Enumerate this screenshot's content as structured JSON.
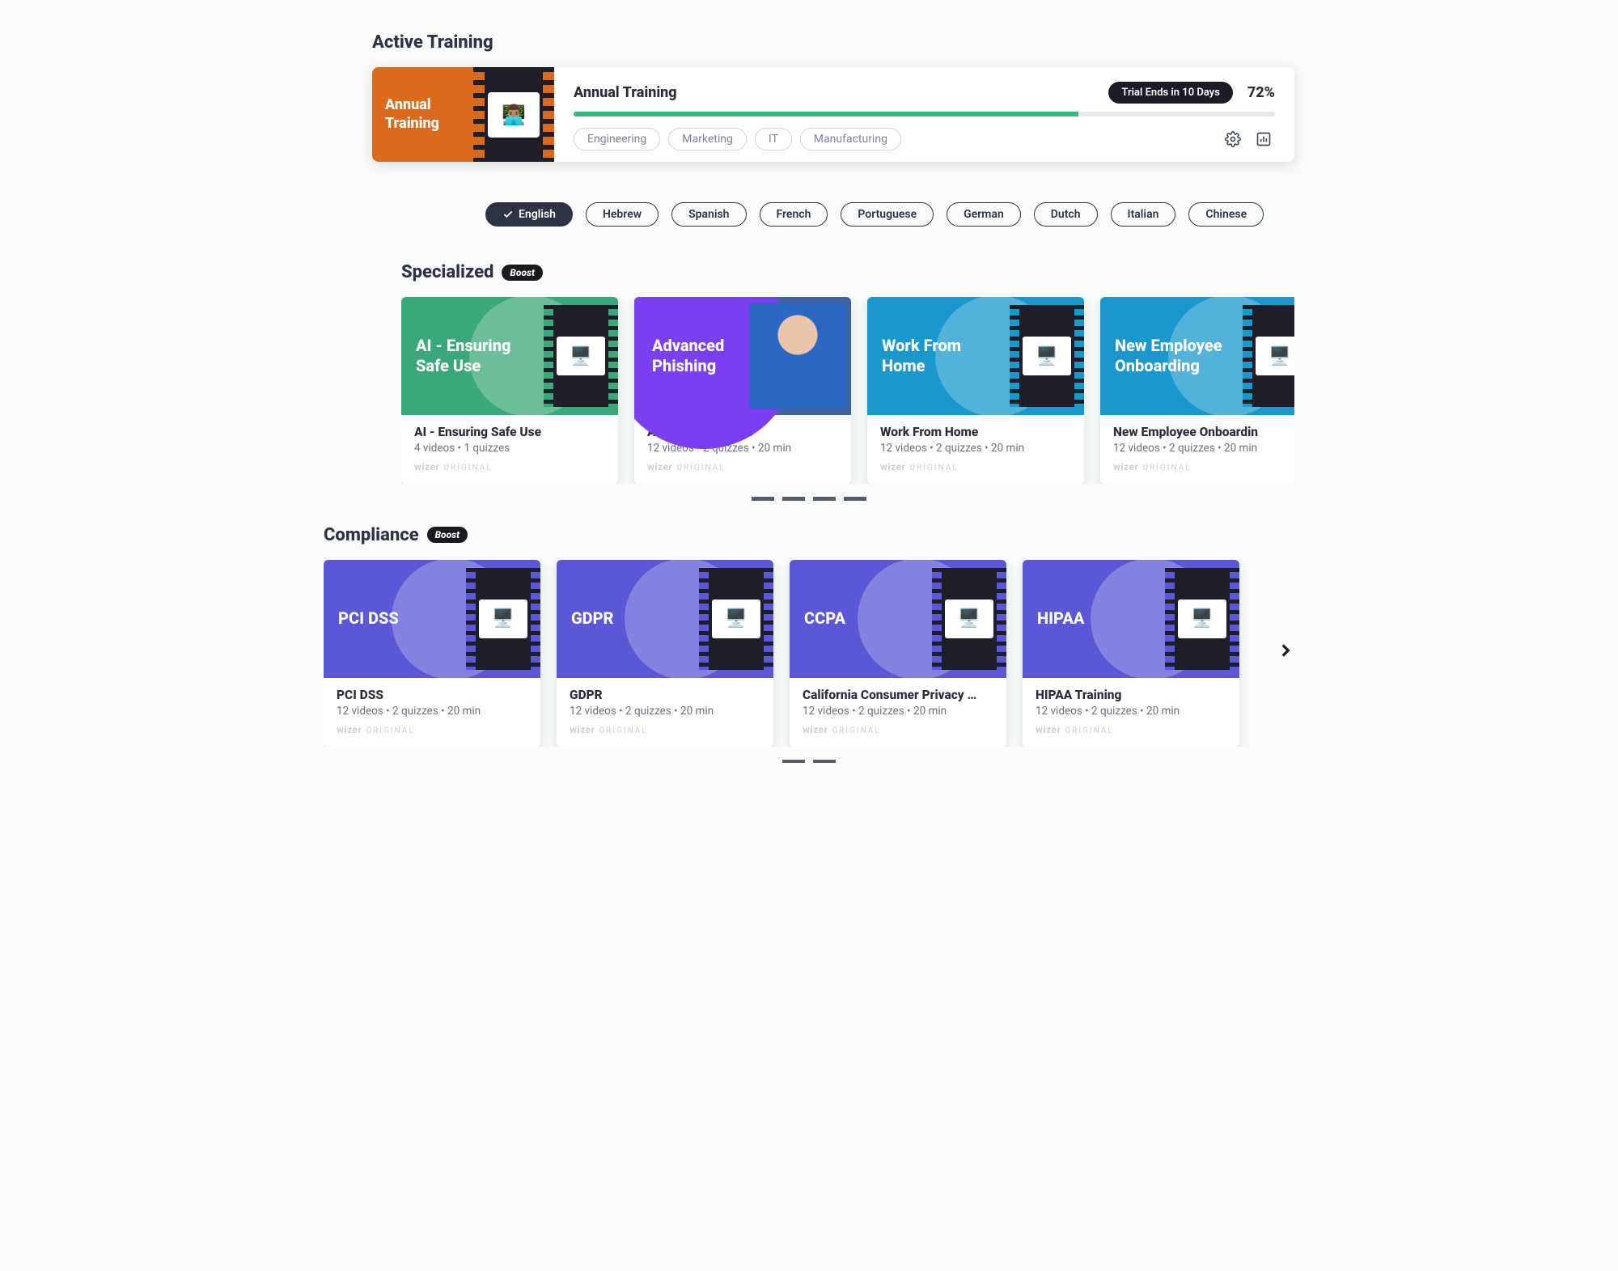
{
  "sections": {
    "active_heading": "Active Training",
    "specialized_heading": "Specialized",
    "compliance_heading": "Compliance",
    "boost_label": "Boost"
  },
  "active": {
    "thumb_label": "Annual Training",
    "title": "Annual Training",
    "trial_badge": "Trial Ends in 10 Days",
    "percent_label": "72%",
    "percent_value": 72,
    "tags": [
      "Engineering",
      "Marketing",
      "IT",
      "Manufacturing"
    ]
  },
  "languages": [
    {
      "label": "English",
      "active": true
    },
    {
      "label": "Hebrew"
    },
    {
      "label": "Spanish"
    },
    {
      "label": "French"
    },
    {
      "label": "Portuguese"
    },
    {
      "label": "German"
    },
    {
      "label": "Dutch"
    },
    {
      "label": "Italian"
    },
    {
      "label": "Chinese"
    }
  ],
  "specialized": [
    {
      "thumb_title": "AI - Ensuring Safe Use",
      "color": "green",
      "title": "AI - Ensuring Safe Use",
      "meta": "4 videos • 1 quizzes"
    },
    {
      "thumb_title": "Advanced Phishing",
      "color": "phish",
      "title": "Annual Training 20",
      "meta": "12 videos • 2 quizzes • 20 min"
    },
    {
      "thumb_title": "Work From Home",
      "color": "blue",
      "title": "Work From Home",
      "meta": "12 videos • 2 quizzes • 20 min"
    },
    {
      "thumb_title": "New Employee Onboarding",
      "color": "lblue",
      "title": "New Employee Onboardin",
      "meta": "12 videos • 2 quizzes • 20 min"
    }
  ],
  "compliance": [
    {
      "thumb_title": "PCI DSS",
      "color": "purple",
      "title": "PCI DSS",
      "meta": "12 videos • 2 quizzes • 20 min"
    },
    {
      "thumb_title": "GDPR",
      "color": "purple",
      "title": "GDPR",
      "meta": "12 videos • 2 quizzes • 20 min"
    },
    {
      "thumb_title": "CCPA",
      "color": "purple",
      "title": "California Consumer Privacy …",
      "meta": "12 videos • 2 quizzes • 20 min"
    },
    {
      "thumb_title": "HIPAA",
      "color": "purple",
      "title": "HIPAA Training",
      "meta": "12 videos • 2 quizzes • 20 min"
    }
  ],
  "brand": {
    "name": "wizer",
    "tag": "ORIGINAL"
  },
  "icons": {
    "gear": "gear-icon",
    "chart": "bar-chart-icon",
    "check": "check-icon",
    "chevron": "chevron-right-icon"
  }
}
